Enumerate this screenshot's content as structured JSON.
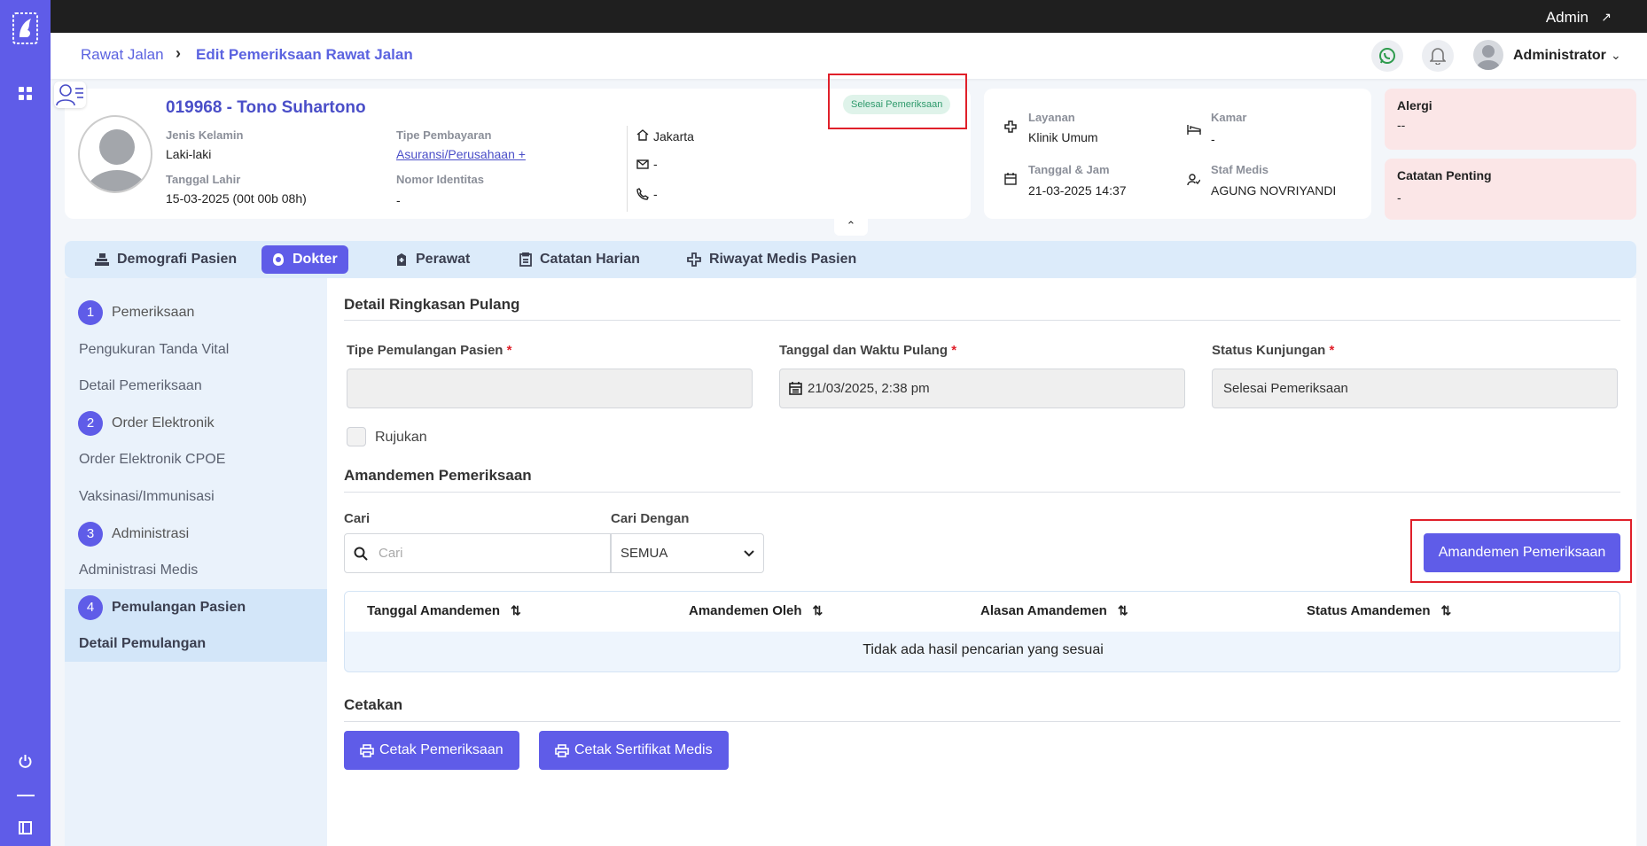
{
  "topbar": {
    "admin_label": "Admin"
  },
  "breadcrumb": {
    "parent": "Rawat Jalan",
    "current": "Edit Pemeriksaan Rawat Jalan"
  },
  "user": {
    "name": "Administrator"
  },
  "patient": {
    "title": "019968 - Tono Suhartono",
    "status": "Selesai Pemeriksaan",
    "gender_label": "Jenis Kelamin",
    "gender": "Laki-laki",
    "dob_label": "Tanggal Lahir",
    "dob": "15-03-2025 (00t 00b 08h)",
    "payment_label": "Tipe Pembayaran",
    "payment": "Asuransi/Perusahaan +",
    "id_label": "Nomor Identitas",
    "id_value": "-",
    "city": "Jakarta",
    "email": "-",
    "phone": "-"
  },
  "service": {
    "layanan_label": "Layanan",
    "layanan": "Klinik Umum",
    "kamar_label": "Kamar",
    "kamar": "-",
    "datetime_label": "Tanggal & Jam",
    "datetime": "21-03-2025 14:37",
    "staff_label": "Staf Medis",
    "staff": "AGUNG NOVRIYANDI"
  },
  "alergi": {
    "label": "Alergi",
    "value": "--"
  },
  "catatan": {
    "label": "Catatan Penting",
    "value": "-"
  },
  "tabs": [
    {
      "label": "Demografi Pasien"
    },
    {
      "label": "Dokter"
    },
    {
      "label": "Perawat"
    },
    {
      "label": "Catatan Harian"
    },
    {
      "label": "Riwayat Medis Pasien"
    }
  ],
  "steps": [
    {
      "num": "1",
      "label": "Pemeriksaan",
      "subs": [
        "Pengukuran Tanda Vital",
        "Detail Pemeriksaan"
      ]
    },
    {
      "num": "2",
      "label": "Order Elektronik",
      "subs": [
        "Order Elektronik CPOE",
        "Vaksinasi/Immunisasi"
      ]
    },
    {
      "num": "3",
      "label": "Administrasi",
      "subs": [
        "Administrasi Medis"
      ]
    },
    {
      "num": "4",
      "label": "Pemulangan Pasien",
      "subs": [
        "Detail Pemulangan"
      ]
    }
  ],
  "discharge": {
    "section_title": "Detail Ringkasan Pulang",
    "type_label": "Tipe Pemulangan Pasien",
    "type_value": "",
    "datetime_label": "Tanggal dan Waktu Pulang",
    "datetime_value": "21/03/2025, 2:38 pm",
    "status_label": "Status Kunjungan",
    "status_value": "Selesai Pemeriksaan",
    "required_mark": "*",
    "referral_label": "Rujukan"
  },
  "amendment": {
    "section_title": "Amandemen Pemeriksaan",
    "search_label": "Cari",
    "search_placeholder": "Cari",
    "search_by_label": "Cari Dengan",
    "search_by_value": "SEMUA",
    "button": "Amandemen Pemeriksaan",
    "columns": [
      "Tanggal Amandemen",
      "Amandemen Oleh",
      "Alasan Amandemen",
      "Status Amandemen"
    ],
    "empty_text": "Tidak ada hasil pencarian yang sesuai"
  },
  "print": {
    "section_title": "Cetakan",
    "btn_exam": "Cetak Pemeriksaan",
    "btn_cert": "Cetak Sertifikat Medis"
  },
  "colors": {
    "accent": "#5f5ce8",
    "sidebar": "#5f5ce8",
    "highlight": "#e0202a",
    "status_bg": "#dff3ea"
  }
}
